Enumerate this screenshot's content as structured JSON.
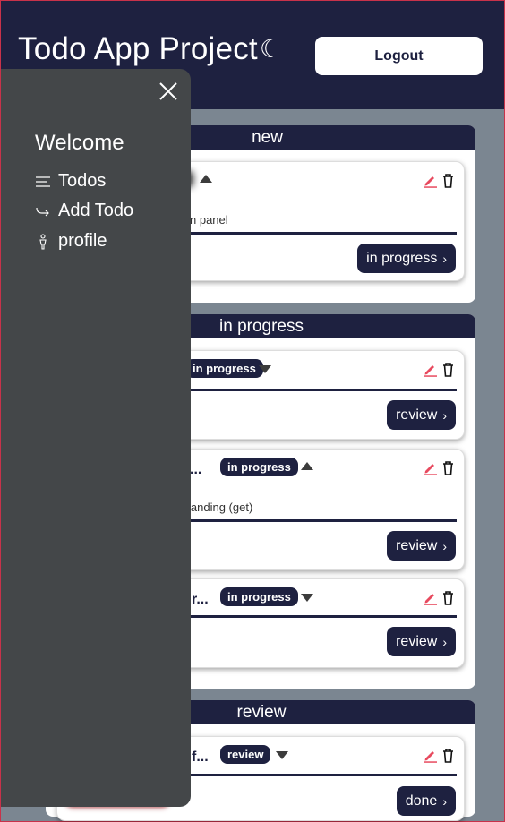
{
  "header": {
    "title": "Todo App Project",
    "logout_label": "Logout",
    "bg_color": "#1e2140"
  },
  "sidebar": {
    "welcome": "Welcome",
    "items": [
      {
        "label": "Todos",
        "icon": "menu-lines-icon"
      },
      {
        "label": "Add Todo",
        "icon": "arrow-hook-icon"
      },
      {
        "label": "profile",
        "icon": "person-icon"
      }
    ]
  },
  "columns": [
    {
      "title": "new",
      "cards": [
        {
          "desc": "n panel",
          "action": "in progress"
        }
      ]
    },
    {
      "title": "in progress",
      "cards": [
        {
          "badge": "in progress",
          "action": "review"
        },
        {
          "title": "...",
          "badge": "in progress",
          "desc": "landing (get)",
          "action": "review"
        },
        {
          "title": "r...",
          "badge": "in progress",
          "action": "review"
        }
      ]
    },
    {
      "title": "review",
      "cards": [
        {
          "title": "f...",
          "badge": "review",
          "action": "done"
        }
      ]
    }
  ],
  "colors": {
    "accent": "#1e2140",
    "edit": "#e84a5f",
    "overlay": "#444749",
    "page_bg": "#7b8691"
  }
}
